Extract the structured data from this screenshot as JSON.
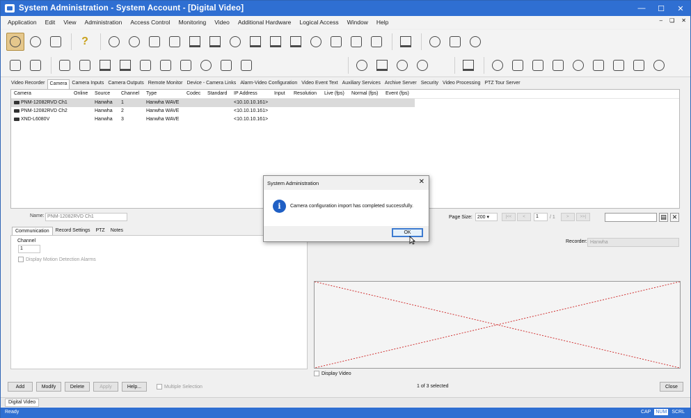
{
  "window": {
    "title": "System Administration - System Account - [Digital Video]"
  },
  "menubar": [
    "Application",
    "Edit",
    "View",
    "Administration",
    "Access Control",
    "Monitoring",
    "Video",
    "Additional Hardware",
    "Logical Access",
    "Window",
    "Help"
  ],
  "toolbar_row1_icons": [
    "search-credentials-icon",
    "find-icon",
    "users-search-icon",
    "help-icon",
    "person-add-icon",
    "person-lock-icon",
    "person-hierarchy-icon",
    "document-icon",
    "card-icon",
    "card-group-icon",
    "user-tools-icon",
    "monitor-icon",
    "monitor-add-icon",
    "monitor-gear-icon",
    "globe-icon",
    "list-icon",
    "cards-icon",
    "window-icon",
    "printer-icon",
    "clock-icon",
    "badge-icon",
    "network-user-icon"
  ],
  "toolbar_row2_icons": [
    "tree-icon",
    "calendar-grid-icon",
    "panel-icon",
    "tablet-icon",
    "io-module-icon",
    "printer-alt-icon",
    "calendar-icon",
    "exit-door-icon",
    "image-icon",
    "refresh-icon",
    "list-sort-icon",
    "grid-icon",
    "alarm-icon",
    "monitor-video-icon",
    "person-stand-icon",
    "gear-icon",
    "camera-icon",
    "fire-icon",
    "reader-icon",
    "wand-icon",
    "keypad-icon",
    "disc-icon",
    "hourglass-icon",
    "network-transfer-icon",
    "network-export-icon",
    "users-network-icon"
  ],
  "tabs": [
    "Video Recorder",
    "Camera",
    "Camera Inputs",
    "Camera Outputs",
    "Remote Monitor",
    "Device - Camera Links",
    "Alarm-Video Configuration",
    "Video Event Text",
    "Auxiliary Services",
    "Archive Server",
    "Security",
    "Video Processing",
    "PTZ Tour Server"
  ],
  "active_tab": "Camera",
  "grid": {
    "columns": [
      "Camera",
      "Online",
      "Source",
      "Channel",
      "Type",
      "Codec",
      "Standard",
      "IP Address",
      "Input",
      "Resolution",
      "Live (fps)",
      "Normal (fps)",
      "Event (fps)"
    ],
    "rows": [
      [
        "PNM-12082RVD Ch1",
        "",
        "Hanwha",
        "1",
        "Hanwha WAVE",
        "",
        "",
        "<10.10.10.161>",
        "",
        "",
        "",
        "",
        ""
      ],
      [
        "PNM-12082RVD Ch2",
        "",
        "Hanwha",
        "2",
        "Hanwha WAVE",
        "",
        "",
        "<10.10.10.161>",
        "",
        "",
        "",
        "",
        ""
      ],
      [
        "XND-L6080V",
        "",
        "Hanwha",
        "3",
        "Hanwha WAVE",
        "",
        "",
        "<10.10.10.161>",
        "",
        "",
        "",
        "",
        ""
      ]
    ]
  },
  "detail": {
    "name_label": "Name:",
    "name_value": "PNM-12082RVD Ch1",
    "subtabs": [
      "Communication",
      "Record Settings",
      "PTZ",
      "Notes"
    ],
    "channel_label": "Channel",
    "channel_value": "1",
    "motion_checkbox": "Display Motion Detection Alarms"
  },
  "pager": {
    "page_size_label": "Page Size:",
    "page_size": "200",
    "page": "1",
    "page_total": "/ 1"
  },
  "recorder": {
    "label": "Recorder:",
    "value": "Hanwha"
  },
  "display_video": "Display Video",
  "buttons": {
    "add": "Add",
    "modify": "Modify",
    "delete": "Delete",
    "apply": "Apply",
    "help": "Help...",
    "close": "Close"
  },
  "multiple_selection": "Multiple Selection",
  "selection_count": "1 of 3 selected",
  "doc_tab": "Digital Video",
  "status": {
    "ready": "Ready",
    "keys": [
      "CAP",
      "NUM",
      "SCRL"
    ]
  },
  "dialog": {
    "title": "System Administration",
    "message": "Camera configuration import has completed successfully.",
    "ok": "OK"
  }
}
